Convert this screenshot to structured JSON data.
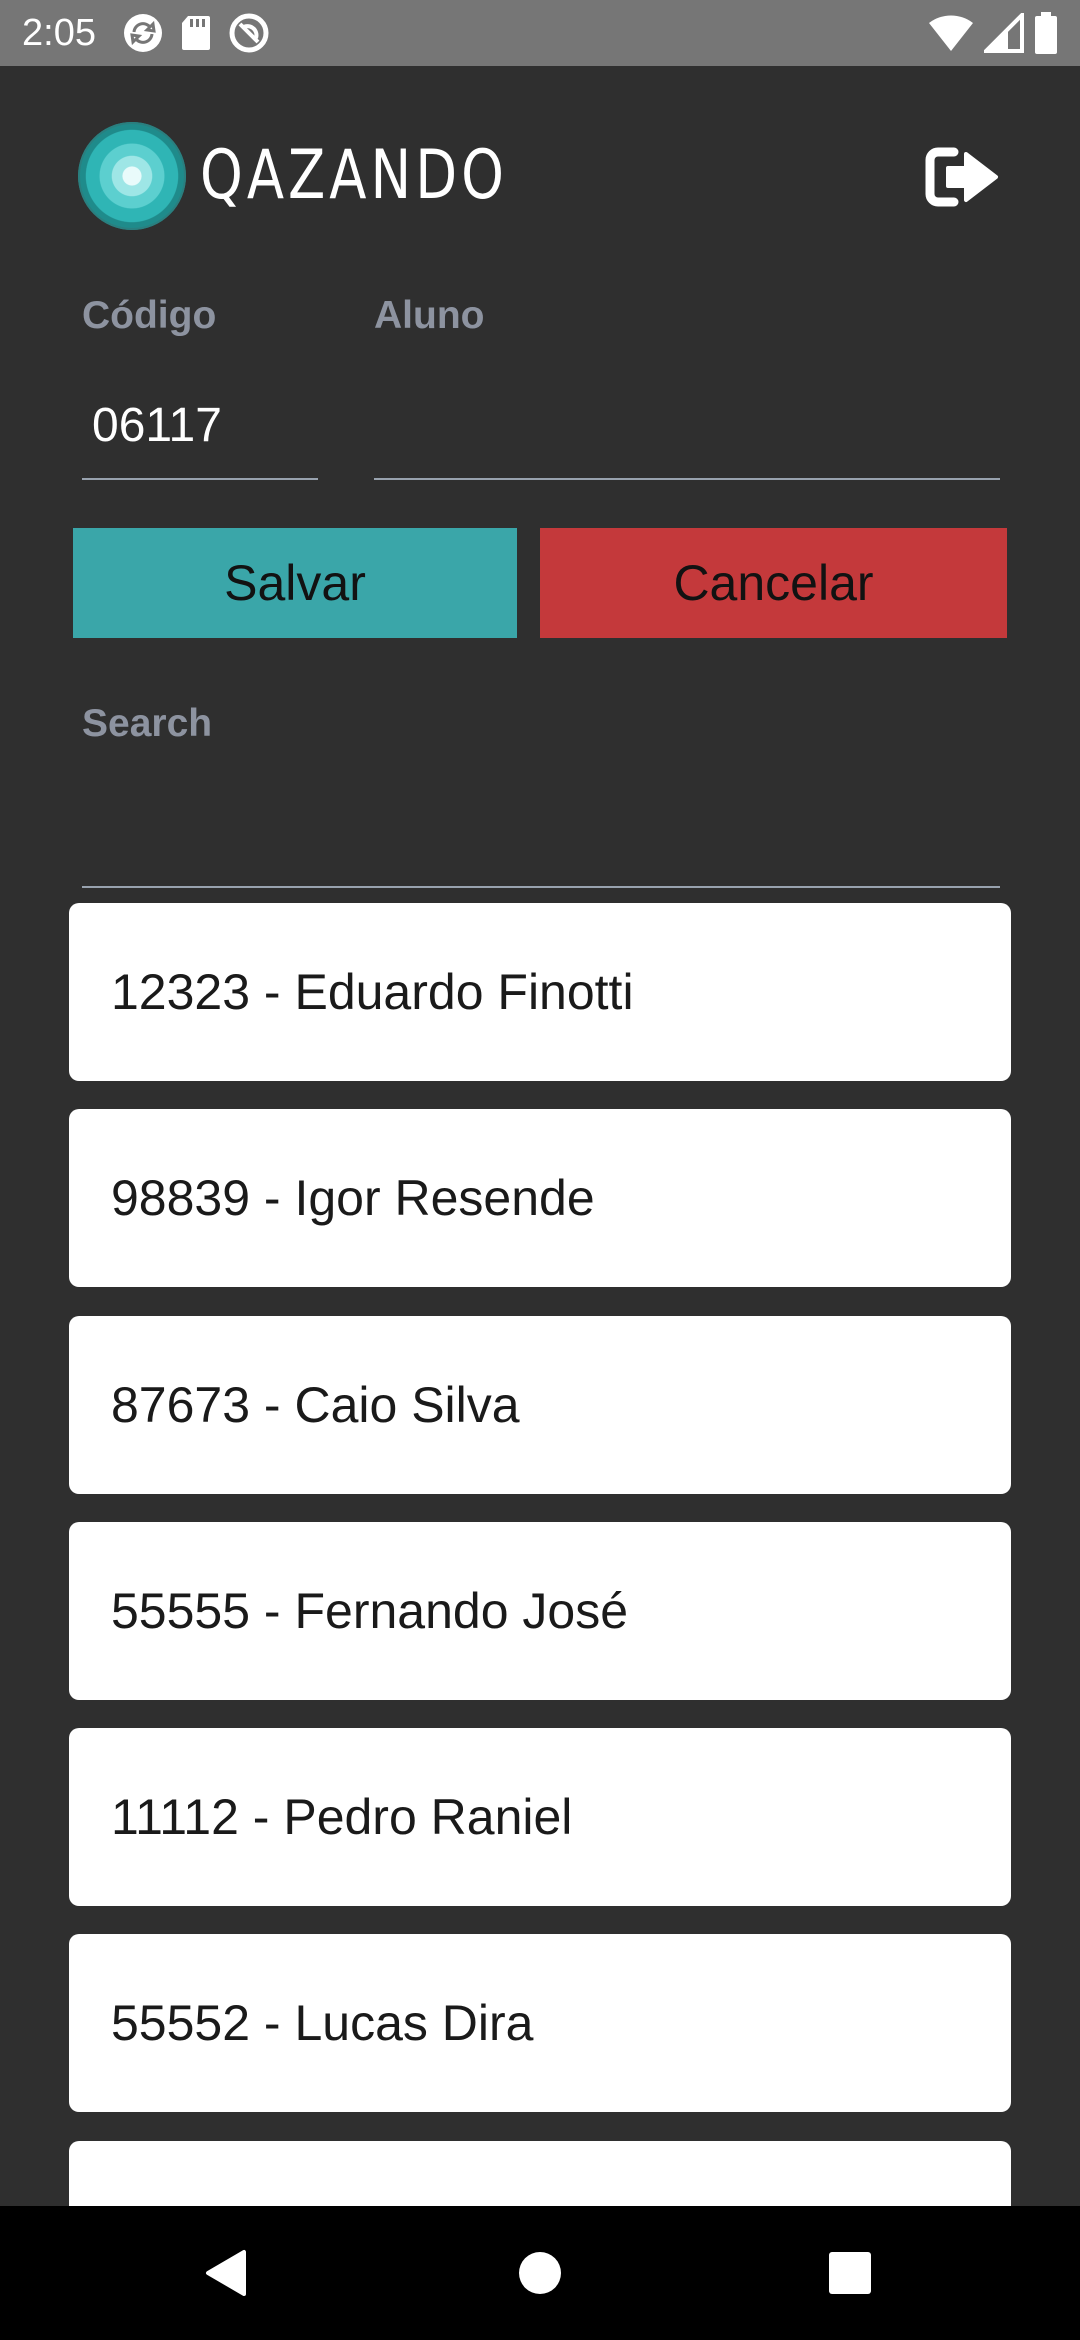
{
  "status_bar": {
    "time": "2:05"
  },
  "header": {
    "logo_text": "QAZANDO"
  },
  "form": {
    "codigo_label": "Código",
    "codigo_value": "06117",
    "aluno_label": "Aluno",
    "aluno_value": "",
    "save_label": "Salvar",
    "cancel_label": "Cancelar",
    "search_label": "Search",
    "search_value": ""
  },
  "students": [
    {
      "label": "12323 - Eduardo Finotti"
    },
    {
      "label": "98839 - Igor Resende"
    },
    {
      "label": "87673 - Caio Silva"
    },
    {
      "label": "55555 - Fernando José"
    },
    {
      "label": "11112 - Pedro Raniel"
    },
    {
      "label": "55552 - Lucas Dira"
    },
    {
      "label": ""
    }
  ],
  "colors": {
    "background": "#2f2f2f",
    "save_button": "#3aa6a9",
    "cancel_button": "#c4393b",
    "label": "#8d93a0",
    "status_bar": "#767676"
  }
}
